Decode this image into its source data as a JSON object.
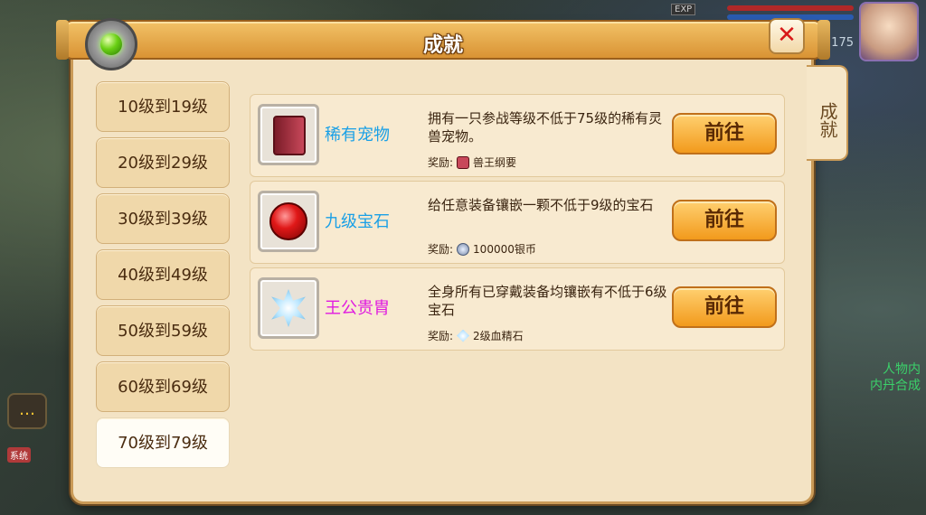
{
  "panel": {
    "title": "成就",
    "side_tab": "成就"
  },
  "hud": {
    "exp_tag": "EXP",
    "level": "175",
    "chat_icon": "chat-bubble-icon",
    "system_tag": "系统",
    "right_text_1": "人物内",
    "right_text_2": "内丹合成"
  },
  "levels": [
    {
      "label": "10级到19级"
    },
    {
      "label": "20级到29级"
    },
    {
      "label": "30级到39级"
    },
    {
      "label": "40级到49级"
    },
    {
      "label": "50级到59级"
    },
    {
      "label": "60级到69级"
    },
    {
      "label": "70级到79级"
    }
  ],
  "selected_level_index": 6,
  "achievements": [
    {
      "name": "稀有宠物",
      "name_color": "#1aa0e6",
      "icon": "pet-book-icon",
      "description": "拥有一只参战等级不低于75级的稀有灵兽宠物。",
      "reward_label": "奖励:",
      "reward_icon": "book-icon",
      "reward_text": "兽王纲要",
      "button": "前往"
    },
    {
      "name": "九级宝石",
      "name_color": "#1aa0e6",
      "icon": "ruby-gem-icon",
      "description": "给任意装备镶嵌一颗不低于9级的宝石",
      "reward_label": "奖励:",
      "reward_icon": "silver-coin-icon",
      "reward_text": "100000银币",
      "button": "前往"
    },
    {
      "name": "王公贵胄",
      "name_color": "#e01ae0",
      "icon": "ice-crystal-icon",
      "description": "全身所有已穿戴装备均镶嵌有不低于6级宝石",
      "reward_label": "奖励:",
      "reward_icon": "blood-crystal-icon",
      "reward_text": "2级血精石",
      "button": "前往"
    }
  ]
}
